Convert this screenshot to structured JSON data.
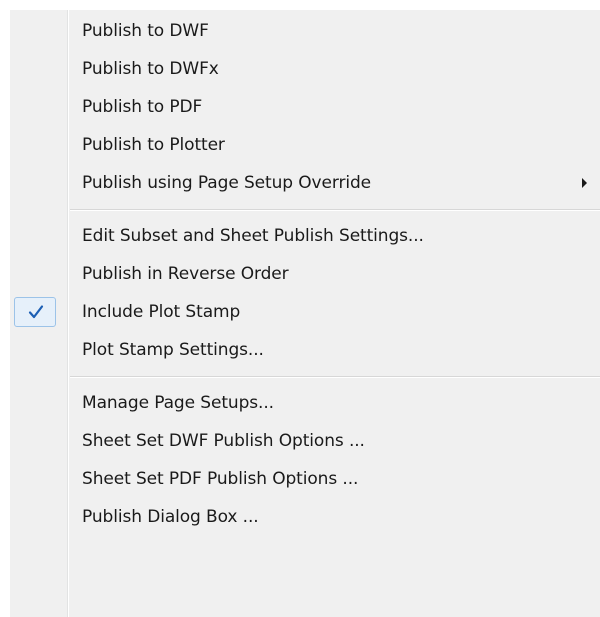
{
  "menu": {
    "groups": [
      {
        "items": [
          {
            "label": "Publish to DWF"
          },
          {
            "label": "Publish to DWFx"
          },
          {
            "label": "Publish to PDF"
          },
          {
            "label": "Publish to Plotter"
          },
          {
            "label": "Publish using Page Setup Override",
            "has_submenu": true
          }
        ]
      },
      {
        "items": [
          {
            "label": "Edit Subset and Sheet Publish Settings..."
          },
          {
            "label": "Publish in Reverse Order"
          },
          {
            "label": "Include Plot Stamp",
            "checked": true
          },
          {
            "label": "Plot Stamp Settings..."
          }
        ]
      },
      {
        "items": [
          {
            "label": "Manage Page Setups..."
          },
          {
            "label": "Sheet Set DWF Publish Options ..."
          },
          {
            "label": "Sheet Set PDF Publish Options ..."
          },
          {
            "label": "Publish Dialog Box ..."
          }
        ]
      }
    ]
  },
  "icons": {
    "checkmark": "checkmark-icon",
    "submenu_arrow": "submenu-arrow-icon"
  },
  "colors": {
    "menu_background": "#f0f0f0",
    "checkmark": "#1c5fb4",
    "check_highlight": "#e6f0fa"
  }
}
